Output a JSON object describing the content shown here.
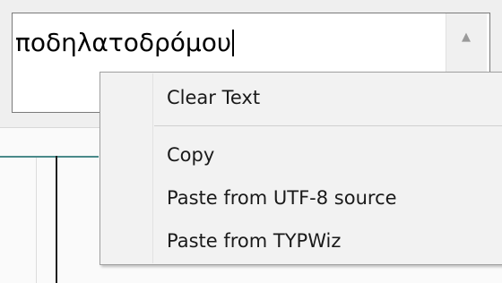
{
  "textbox": {
    "value": "ποδηλατοδρόμου"
  },
  "scrollbar": {
    "up_arrow": "▲"
  },
  "context_menu": {
    "items": [
      {
        "label": "Clear Text"
      },
      {
        "label": "Copy"
      },
      {
        "label": "Paste from UTF-8 source"
      },
      {
        "label": "Paste from TYPWiz"
      }
    ]
  }
}
